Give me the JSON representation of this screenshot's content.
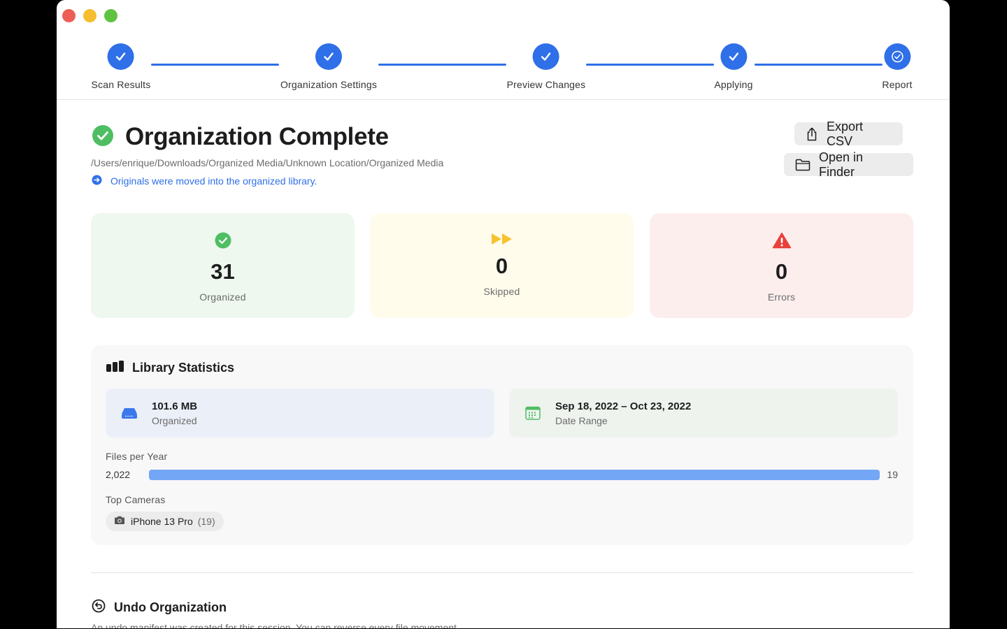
{
  "stepper": {
    "steps": [
      {
        "label": "Scan Results",
        "state": "done"
      },
      {
        "label": "Organization Settings",
        "state": "done"
      },
      {
        "label": "Preview Changes",
        "state": "done"
      },
      {
        "label": "Applying",
        "state": "done"
      },
      {
        "label": "Report",
        "state": "current"
      }
    ],
    "accent": "#2f6fe8"
  },
  "header": {
    "title": "Organization Complete",
    "path": "/Users/enrique/Downloads/Organized Media/Unknown Location/Organized Media",
    "note": "Originals were moved into the organized library."
  },
  "actions": {
    "export_label": "Export CSV",
    "finder_label": "Open in Finder"
  },
  "stats": {
    "organized": {
      "value": "31",
      "label": "Organized"
    },
    "skipped": {
      "value": "0",
      "label": "Skipped"
    },
    "errors": {
      "value": "0",
      "label": "Errors"
    }
  },
  "library": {
    "title": "Library Statistics",
    "size": {
      "value": "101.6 MB",
      "label": "Organized"
    },
    "date_range": {
      "value": "Sep 18, 2022 – Oct 23, 2022",
      "label": "Date Range"
    },
    "files_per_year_label": "Files per Year",
    "years": [
      {
        "year": "2,022",
        "count": "19",
        "fraction": 1.0
      }
    ],
    "top_cameras_label": "Top Cameras",
    "cameras": [
      {
        "name": "iPhone 13 Pro",
        "count": "(19)"
      }
    ]
  },
  "undo": {
    "title": "Undo Organization",
    "description": "An undo manifest was created for this session. You can reverse every file movement."
  },
  "icons": {
    "step_done": "checkmark-icon",
    "step_current": "check-circle-icon",
    "title": "checkmark-circle-icon",
    "note": "arrow-right-circle-icon",
    "export": "share-icon",
    "finder": "folder-icon",
    "organized": "checkmark-circle-icon",
    "skipped": "fast-forward-icon",
    "errors": "warning-triangle-icon",
    "library": "bar-chart-icon",
    "size": "drive-icon",
    "date": "calendar-icon",
    "camera": "camera-icon",
    "undo": "undo-circle-icon"
  }
}
